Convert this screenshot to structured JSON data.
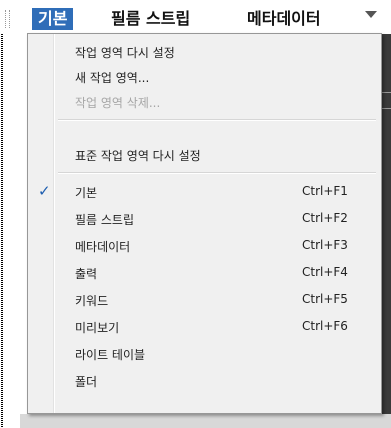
{
  "workspace_bar": {
    "tabs": [
      {
        "label": "기본",
        "active": true
      },
      {
        "label": "필름 스트립",
        "active": false
      },
      {
        "label": "메타데이터",
        "active": false
      }
    ],
    "more_icon": "chevron-down-icon",
    "accent_color": "#2f6db8"
  },
  "menu": {
    "group1": [
      {
        "label": "작업 영역 다시 설정",
        "disabled": false
      },
      {
        "label": "새 작업 영역...",
        "disabled": false
      },
      {
        "label": "작업 영역 삭제...",
        "disabled": true
      }
    ],
    "group2": [
      {
        "label": "표준 작업 영역 다시 설정",
        "disabled": false
      }
    ],
    "group3": [
      {
        "label": "기본",
        "shortcut": "Ctrl+F1",
        "checked": true
      },
      {
        "label": "필름 스트립",
        "shortcut": "Ctrl+F2",
        "checked": false
      },
      {
        "label": "메타데이터",
        "shortcut": "Ctrl+F3",
        "checked": false
      },
      {
        "label": "출력",
        "shortcut": "Ctrl+F4",
        "checked": false
      },
      {
        "label": "키워드",
        "shortcut": "Ctrl+F5",
        "checked": false
      },
      {
        "label": "미리보기",
        "shortcut": "Ctrl+F6",
        "checked": false
      },
      {
        "label": "라이트 테이블",
        "shortcut": "",
        "checked": false
      },
      {
        "label": "폴더",
        "shortcut": "",
        "checked": false
      }
    ],
    "check_mark": "✓"
  }
}
